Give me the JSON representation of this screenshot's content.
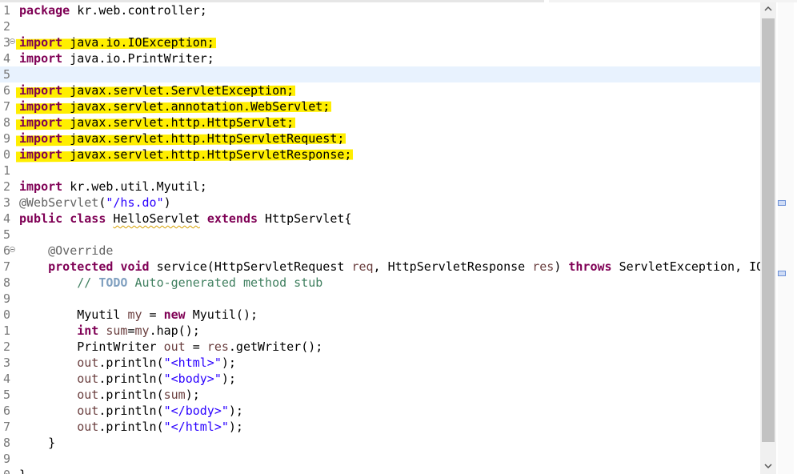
{
  "colors": {
    "highlight": "#ffee00",
    "keyword": "#7f0055",
    "string": "#2a00ff",
    "annotation": "#646464",
    "comment": "#3f7f5f",
    "current_line": "#e8f2fe"
  },
  "lines": [
    {
      "num": "1",
      "text": "package kr.web.controller;"
    },
    {
      "num": "2",
      "text": ""
    },
    {
      "num": "3",
      "text": "import java.io.IOException;",
      "fold": "collapse-icon",
      "highlighted": true
    },
    {
      "num": "4",
      "text": "import java.io.PrintWriter;"
    },
    {
      "num": "5",
      "text": "",
      "current": true
    },
    {
      "num": "6",
      "text": "import javax.servlet.ServletException;",
      "highlighted": true
    },
    {
      "num": "7",
      "text": "import javax.servlet.annotation.WebServlet;",
      "highlighted": true
    },
    {
      "num": "8",
      "text": "import javax.servlet.http.HttpServlet;",
      "highlighted": true
    },
    {
      "num": "9",
      "text": "import javax.servlet.http.HttpServletRequest;",
      "highlighted": true
    },
    {
      "num": "0",
      "text": "import javax.servlet.http.HttpServletResponse;",
      "highlighted": true
    },
    {
      "num": "1",
      "text": ""
    },
    {
      "num": "2",
      "text": "import kr.web.util.Myutil;"
    },
    {
      "num": "3",
      "text": "@WebServlet(\"/hs.do\")"
    },
    {
      "num": "4",
      "text": "public class HelloServlet extends HttpServlet{"
    },
    {
      "num": "5",
      "text": ""
    },
    {
      "num": "6",
      "text": "    @Override",
      "fold": "collapse-icon"
    },
    {
      "num": "7",
      "text": "    protected void service(HttpServletRequest req, HttpServletResponse res) throws ServletException, IO"
    },
    {
      "num": "8",
      "text": "        // TODO Auto-generated method stub"
    },
    {
      "num": "9",
      "text": ""
    },
    {
      "num": "0",
      "text": "        Myutil my = new Myutil();"
    },
    {
      "num": "1",
      "text": "        int sum=my.hap();"
    },
    {
      "num": "2",
      "text": "        PrintWriter out = res.getWriter();"
    },
    {
      "num": "3",
      "text": "        out.println(\"<html>\");"
    },
    {
      "num": "4",
      "text": "        out.println(\"<body>\");"
    },
    {
      "num": "5",
      "text": "        out.println(sum);"
    },
    {
      "num": "6",
      "text": "        out.println(\"</body>\");"
    },
    {
      "num": "7",
      "text": "        out.println(\"</html>\");"
    },
    {
      "num": "8",
      "text": "    }"
    },
    {
      "num": "9",
      "text": ""
    },
    {
      "num": "0",
      "text": "}"
    }
  ],
  "scrollbar": {
    "up_icon": "chevron-up-icon",
    "down_icon": "chevron-down-icon"
  }
}
